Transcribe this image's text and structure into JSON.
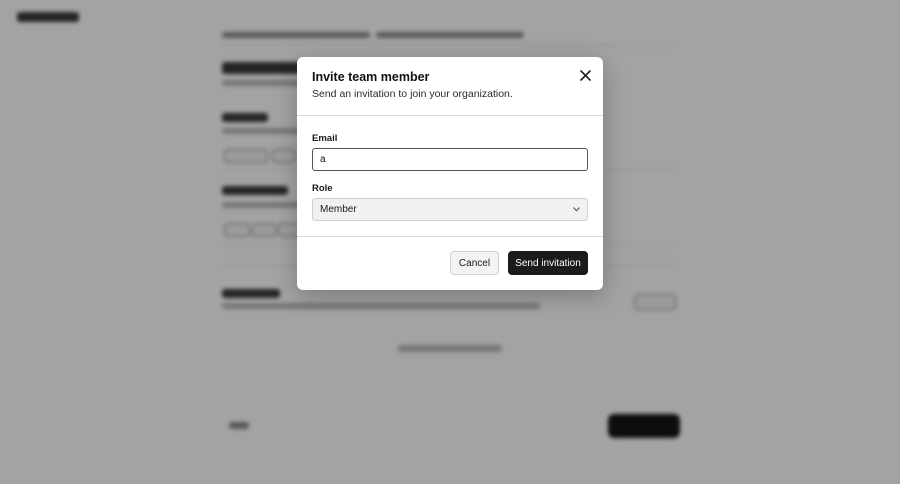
{
  "modal": {
    "title": "Invite team member",
    "subtitle": "Send an invitation to join your organization.",
    "email_label": "Email",
    "email_value": "a",
    "role_label": "Role",
    "role_value": "Member",
    "cancel_label": "Cancel",
    "send_label": "Send invitation"
  },
  "colors": {
    "overlay": "rgba(0,0,0,0.36)",
    "primary_button": "#1b1b1b",
    "secondary_button": "#f3f3f3"
  },
  "icons": {
    "close": "close-icon",
    "select_chevron": "chevron-down-icon"
  }
}
